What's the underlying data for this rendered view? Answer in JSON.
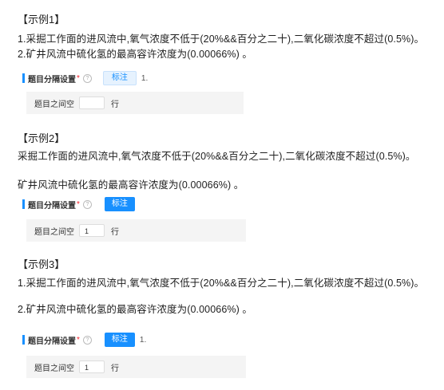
{
  "example1": {
    "header": "【示例1】",
    "lines": [
      "1.采掘工作面的进风流中,氧气浓度不低于(20%&&百分之二十),二氧化碳浓度不超过(0.5%)。",
      "2.矿井风流中硫化氢的最高容许浓度为(0.00066%) 。"
    ],
    "setting": {
      "label": "题目分隔设置",
      "required_mark": "*",
      "help_glyph": "?",
      "button_label": "标注",
      "after_button": "1."
    },
    "spacing": {
      "label": "题目之间空",
      "value": "",
      "unit": "行"
    }
  },
  "example2": {
    "header": "【示例2】",
    "lines": [
      "采掘工作面的进风流中,氧气浓度不低于(20%&&百分之二十),二氧化碳浓度不超过(0.5%)。",
      "矿井风流中硫化氢的最高容许浓度为(0.00066%) 。"
    ],
    "setting": {
      "label": "题目分隔设置",
      "required_mark": "*",
      "help_glyph": "?",
      "button_label": "标注"
    },
    "spacing": {
      "label": "题目之间空",
      "value": "1",
      "unit": "行"
    }
  },
  "example3": {
    "header": "【示例3】",
    "lines": [
      "1.采掘工作面的进风流中,氧气浓度不低于(20%&&百分之二十),二氧化碳浓度不超过(0.5%)。",
      "2.矿井风流中硫化氢的最高容许浓度为(0.00066%) 。"
    ],
    "setting": {
      "label": "题目分隔设置",
      "required_mark": "*",
      "help_glyph": "?",
      "button_label": "标注",
      "after_button": "1."
    },
    "spacing": {
      "label": "题目之间空",
      "value": "1",
      "unit": "行"
    }
  },
  "colors": {
    "accent": "#1890ff",
    "required": "#f5222d",
    "panel_bg": "#f4f4f4"
  }
}
